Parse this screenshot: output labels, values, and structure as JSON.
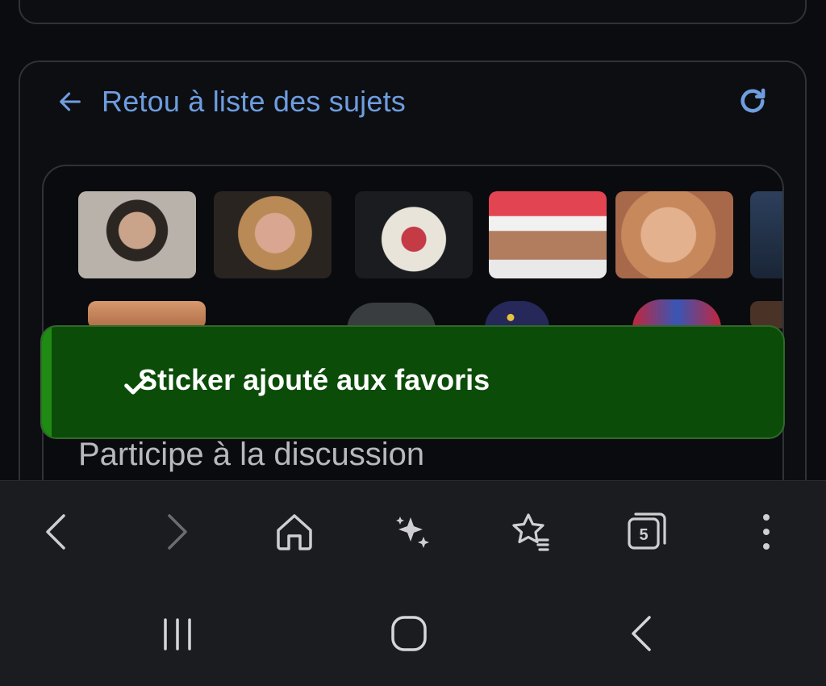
{
  "header": {
    "back_label": "Retou à liste des sujets"
  },
  "stickers": {
    "row1": [
      "sticker-1",
      "sticker-2",
      "sticker-3",
      "sticker-4",
      "sticker-5",
      "sticker-6"
    ],
    "row2": [
      "sticker-7",
      "sticker-8",
      "sticker-9",
      "sticker-10",
      "sticker-11"
    ]
  },
  "compose": {
    "placeholder": "Participe à la discussion"
  },
  "toast": {
    "message": "Sticker ajouté aux favoris",
    "color": "#0b4c08"
  },
  "browser_toolbar": {
    "tab_count": "5",
    "icons": [
      "back-icon",
      "forward-icon",
      "home-icon",
      "sparkle-icon",
      "bookmarks-icon",
      "tabs-icon",
      "more-icon"
    ]
  },
  "system_nav": {
    "icons": [
      "recents-icon",
      "home-circle-icon",
      "back-chevron-icon"
    ]
  },
  "colors": {
    "accent": "#6e9de0",
    "background": "#0b0c10",
    "toolbar": "#1b1c1f"
  }
}
